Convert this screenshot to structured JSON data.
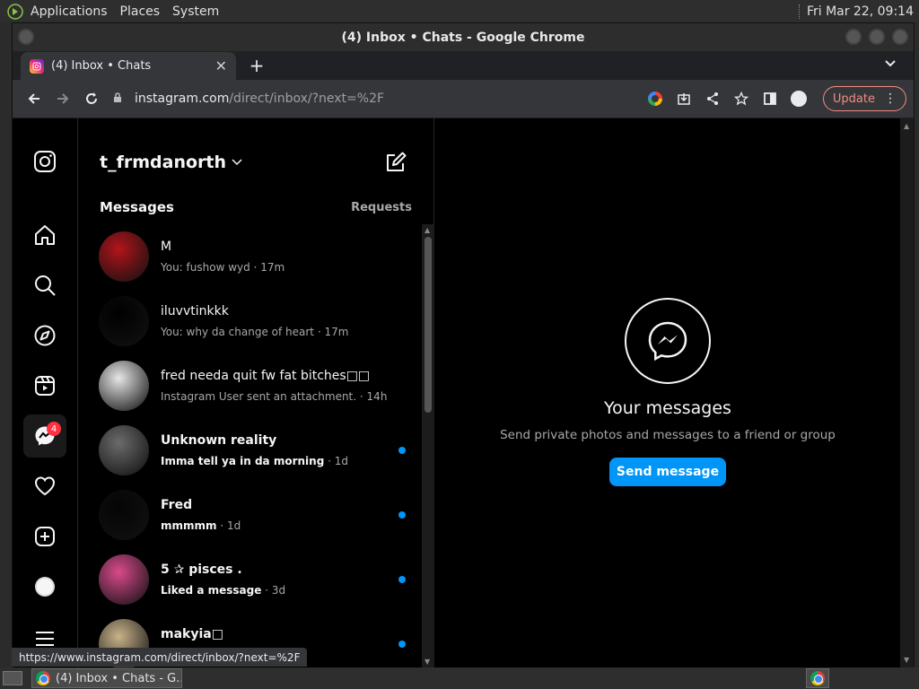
{
  "desktop": {
    "menu": [
      "Applications",
      "Places",
      "System"
    ],
    "clock": "Fri Mar 22, 09:14"
  },
  "window": {
    "title": "(4) Inbox • Chats - Google Chrome"
  },
  "tab": {
    "title": "(4) Inbox • Chats",
    "close": "✕",
    "new_tab": "+"
  },
  "address": {
    "host": "instagram.com",
    "path": "/direct/inbox/?next=%2F"
  },
  "toolbar": {
    "update_label": "Update"
  },
  "instagram": {
    "username": "t_frmdanorth",
    "messages_header": "Messages",
    "requests_label": "Requests",
    "notification_count": "4",
    "conversations": [
      {
        "name": "M",
        "preview": "You: fushow wyd",
        "time": "17m",
        "unread": false,
        "avatar_color": "#b3141b"
      },
      {
        "name": "iluvvtinkkk",
        "preview": "You: why da change of heart",
        "time": "17m",
        "unread": false,
        "avatar_color": "#000000"
      },
      {
        "name": "fred needa quit fw fat bitches□□",
        "preview": "Instagram User sent an attachment.",
        "time": "14h",
        "unread": false,
        "avatar_color": "#e6e6e6"
      },
      {
        "name": "Unknown reality",
        "preview": "Imma tell ya in da morning",
        "time": "1d",
        "unread": true,
        "avatar_color": "#6b6b6b"
      },
      {
        "name": "Fred",
        "preview": "mmmmm",
        "time": "1d",
        "unread": true,
        "avatar_color": "#050505"
      },
      {
        "name": "5 ✰ pisces .",
        "preview": "Liked a message",
        "time": "3d",
        "unread": true,
        "avatar_color": "#d94a8c"
      },
      {
        "name": "makyia□",
        "preview": "",
        "time": "",
        "unread": true,
        "avatar_color": "#c9b28a"
      }
    ],
    "empty_title": "Your messages",
    "empty_subtitle": "Send private photos and messages to a friend or group",
    "send_button": "Send message"
  },
  "status_bar": {
    "url": "https://www.instagram.com/direct/inbox/?next=%2F"
  },
  "taskbar": {
    "task_label": "(4) Inbox • Chats - G..."
  },
  "colors": {
    "accent": "#0095f6",
    "badge": "#ff3040",
    "update": "#f28b82"
  }
}
